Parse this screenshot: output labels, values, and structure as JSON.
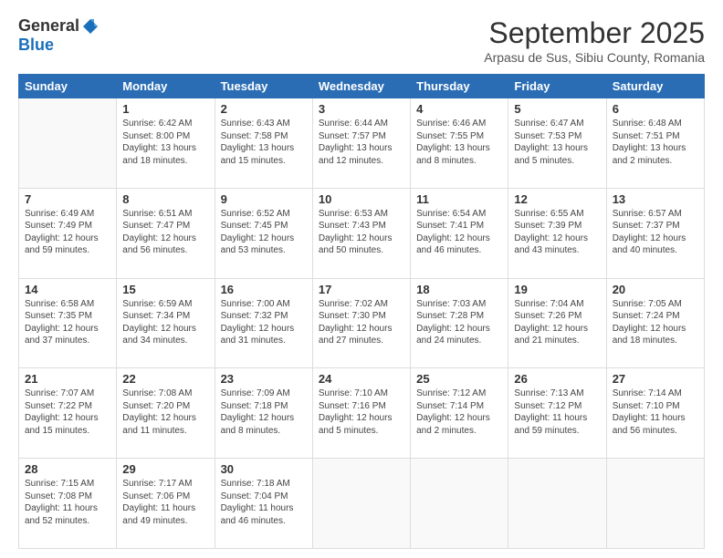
{
  "header": {
    "logo_general": "General",
    "logo_blue": "Blue",
    "month_title": "September 2025",
    "location": "Arpasu de Sus, Sibiu County, Romania"
  },
  "days_of_week": [
    "Sunday",
    "Monday",
    "Tuesday",
    "Wednesday",
    "Thursday",
    "Friday",
    "Saturday"
  ],
  "weeks": [
    [
      {
        "day": "",
        "info": ""
      },
      {
        "day": "1",
        "info": "Sunrise: 6:42 AM\nSunset: 8:00 PM\nDaylight: 13 hours\nand 18 minutes."
      },
      {
        "day": "2",
        "info": "Sunrise: 6:43 AM\nSunset: 7:58 PM\nDaylight: 13 hours\nand 15 minutes."
      },
      {
        "day": "3",
        "info": "Sunrise: 6:44 AM\nSunset: 7:57 PM\nDaylight: 13 hours\nand 12 minutes."
      },
      {
        "day": "4",
        "info": "Sunrise: 6:46 AM\nSunset: 7:55 PM\nDaylight: 13 hours\nand 8 minutes."
      },
      {
        "day": "5",
        "info": "Sunrise: 6:47 AM\nSunset: 7:53 PM\nDaylight: 13 hours\nand 5 minutes."
      },
      {
        "day": "6",
        "info": "Sunrise: 6:48 AM\nSunset: 7:51 PM\nDaylight: 13 hours\nand 2 minutes."
      }
    ],
    [
      {
        "day": "7",
        "info": "Sunrise: 6:49 AM\nSunset: 7:49 PM\nDaylight: 12 hours\nand 59 minutes."
      },
      {
        "day": "8",
        "info": "Sunrise: 6:51 AM\nSunset: 7:47 PM\nDaylight: 12 hours\nand 56 minutes."
      },
      {
        "day": "9",
        "info": "Sunrise: 6:52 AM\nSunset: 7:45 PM\nDaylight: 12 hours\nand 53 minutes."
      },
      {
        "day": "10",
        "info": "Sunrise: 6:53 AM\nSunset: 7:43 PM\nDaylight: 12 hours\nand 50 minutes."
      },
      {
        "day": "11",
        "info": "Sunrise: 6:54 AM\nSunset: 7:41 PM\nDaylight: 12 hours\nand 46 minutes."
      },
      {
        "day": "12",
        "info": "Sunrise: 6:55 AM\nSunset: 7:39 PM\nDaylight: 12 hours\nand 43 minutes."
      },
      {
        "day": "13",
        "info": "Sunrise: 6:57 AM\nSunset: 7:37 PM\nDaylight: 12 hours\nand 40 minutes."
      }
    ],
    [
      {
        "day": "14",
        "info": "Sunrise: 6:58 AM\nSunset: 7:35 PM\nDaylight: 12 hours\nand 37 minutes."
      },
      {
        "day": "15",
        "info": "Sunrise: 6:59 AM\nSunset: 7:34 PM\nDaylight: 12 hours\nand 34 minutes."
      },
      {
        "day": "16",
        "info": "Sunrise: 7:00 AM\nSunset: 7:32 PM\nDaylight: 12 hours\nand 31 minutes."
      },
      {
        "day": "17",
        "info": "Sunrise: 7:02 AM\nSunset: 7:30 PM\nDaylight: 12 hours\nand 27 minutes."
      },
      {
        "day": "18",
        "info": "Sunrise: 7:03 AM\nSunset: 7:28 PM\nDaylight: 12 hours\nand 24 minutes."
      },
      {
        "day": "19",
        "info": "Sunrise: 7:04 AM\nSunset: 7:26 PM\nDaylight: 12 hours\nand 21 minutes."
      },
      {
        "day": "20",
        "info": "Sunrise: 7:05 AM\nSunset: 7:24 PM\nDaylight: 12 hours\nand 18 minutes."
      }
    ],
    [
      {
        "day": "21",
        "info": "Sunrise: 7:07 AM\nSunset: 7:22 PM\nDaylight: 12 hours\nand 15 minutes."
      },
      {
        "day": "22",
        "info": "Sunrise: 7:08 AM\nSunset: 7:20 PM\nDaylight: 12 hours\nand 11 minutes."
      },
      {
        "day": "23",
        "info": "Sunrise: 7:09 AM\nSunset: 7:18 PM\nDaylight: 12 hours\nand 8 minutes."
      },
      {
        "day": "24",
        "info": "Sunrise: 7:10 AM\nSunset: 7:16 PM\nDaylight: 12 hours\nand 5 minutes."
      },
      {
        "day": "25",
        "info": "Sunrise: 7:12 AM\nSunset: 7:14 PM\nDaylight: 12 hours\nand 2 minutes."
      },
      {
        "day": "26",
        "info": "Sunrise: 7:13 AM\nSunset: 7:12 PM\nDaylight: 11 hours\nand 59 minutes."
      },
      {
        "day": "27",
        "info": "Sunrise: 7:14 AM\nSunset: 7:10 PM\nDaylight: 11 hours\nand 56 minutes."
      }
    ],
    [
      {
        "day": "28",
        "info": "Sunrise: 7:15 AM\nSunset: 7:08 PM\nDaylight: 11 hours\nand 52 minutes."
      },
      {
        "day": "29",
        "info": "Sunrise: 7:17 AM\nSunset: 7:06 PM\nDaylight: 11 hours\nand 49 minutes."
      },
      {
        "day": "30",
        "info": "Sunrise: 7:18 AM\nSunset: 7:04 PM\nDaylight: 11 hours\nand 46 minutes."
      },
      {
        "day": "",
        "info": ""
      },
      {
        "day": "",
        "info": ""
      },
      {
        "day": "",
        "info": ""
      },
      {
        "day": "",
        "info": ""
      }
    ]
  ]
}
